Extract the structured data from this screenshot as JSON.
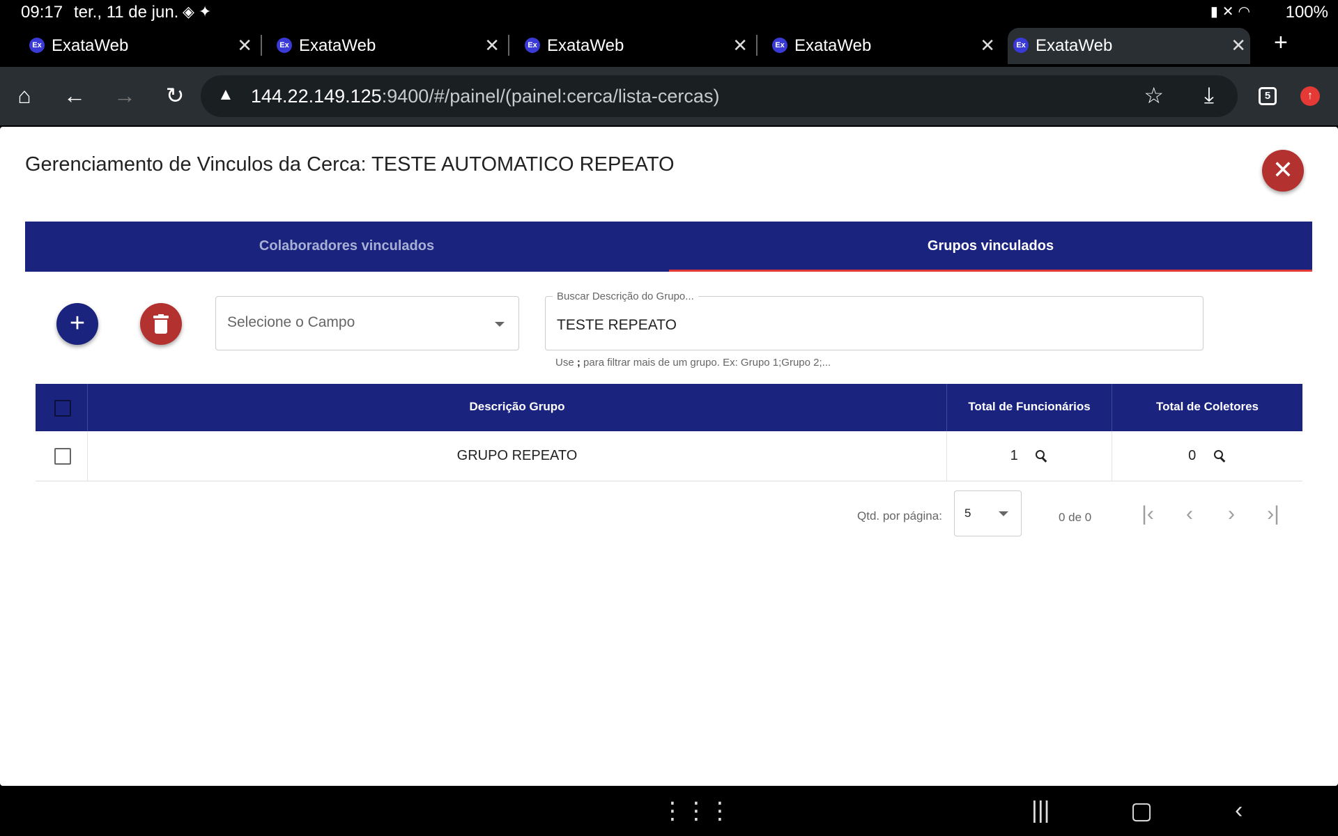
{
  "status": {
    "time": "09:17",
    "date": "ter., 11 de jun.",
    "battery": "100%"
  },
  "browser": {
    "tabs": [
      {
        "title": "ExataWeb",
        "favicon": "Ex"
      },
      {
        "title": "ExataWeb",
        "favicon": "Ex"
      },
      {
        "title": "ExataWeb",
        "favicon": "Ex"
      },
      {
        "title": "ExataWeb",
        "favicon": "Ex"
      },
      {
        "title": "ExataWeb",
        "favicon": "Ex"
      }
    ],
    "url_host": "144.22.149.125",
    "url_rest": ":9400/#/painel/(painel:cerca/lista-cercas)",
    "tab_count": "5"
  },
  "page": {
    "title": "Gerenciamento de Vinculos da Cerca: TESTE AUTOMATICO REPEATO",
    "tabs": [
      "Colaboradores vinculados",
      "Grupos vinculados"
    ],
    "field_select_placeholder": "Selecione o Campo",
    "search_label": "Buscar Descrição do Grupo...",
    "search_value": "TESTE REPEATO",
    "hint_prefix": "Use ",
    "hint_sep": ";",
    "hint_suffix": " para filtrar mais de um grupo. Ex: Grupo 1;Grupo 2;..."
  },
  "table": {
    "headers": [
      "Descrição Grupo",
      "Total de Funcionários",
      "Total de Coletores"
    ],
    "rows": [
      {
        "grupo": "GRUPO REPEATO",
        "funcionarios": "1",
        "coletores": "0"
      }
    ]
  },
  "pager": {
    "label": "Qtd. por página:",
    "page_size": "5",
    "range": "0 de 0"
  },
  "colors": {
    "primary": "#1a237e",
    "danger": "#b3312f",
    "tab_ink": "#e53935"
  }
}
